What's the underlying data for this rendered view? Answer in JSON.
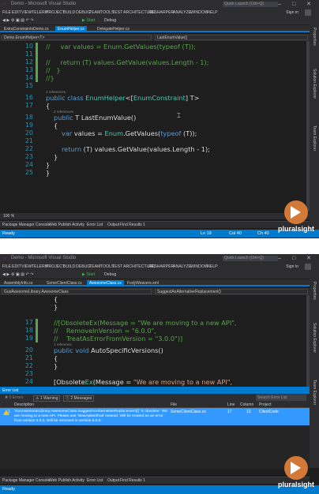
{
  "app": {
    "title": "Demo - Microsoft Visual Studio",
    "quick_launch": "Quick Launch (Ctrl+Q)",
    "menu": [
      "FILE",
      "EDIT",
      "VIEW",
      "TELERIK",
      "PROJECT",
      "BUILD",
      "DEBUG",
      "TEAM",
      "TOOLS",
      "TEST",
      "ARCHITECTURE",
      "RESHARPER",
      "ANALYZE",
      "WINDOW",
      "HELP"
    ],
    "sign_in": "Sign in",
    "toolbar": {
      "start": "▶ Start",
      "config": "Debug"
    },
    "window_buttons": "‒ □ ✕",
    "right_panels": [
      "Properties",
      "Solution Explorer",
      "Team Explorer"
    ],
    "brand_color": "#007acc",
    "pluralsight": "pluralsight"
  },
  "panel1": {
    "tabs": [
      "ExtraConstraintsDemo.cs",
      "EnumHelper.cs",
      "DelegateHelper.cs"
    ],
    "active_tab_index": 1,
    "nav": {
      "type": "Demo.EnumHelper<T>",
      "member": "LastEnumValue()"
    },
    "references_label": "2 references",
    "zoom": "100 %",
    "tool_windows": [
      "Package Manager Console",
      "Web Publish Activity",
      "Error List",
      "Output",
      "Find Results 1"
    ],
    "status": {
      "left": "Ready",
      "ln": "Ln 18",
      "col": "Col 40",
      "ch": "Ch 40"
    },
    "lines": [
      {
        "n": "10",
        "bar": true,
        "indent": 0,
        "parts": [
          {
            "c": "cmt",
            "t": "//     var values = Enum.GetValues(typeof (T));"
          }
        ]
      },
      {
        "n": "11",
        "bar": true,
        "indent": 0,
        "parts": [
          {
            "c": "cmt",
            "t": ""
          }
        ]
      },
      {
        "n": "12",
        "bar": true,
        "indent": 0,
        "parts": [
          {
            "c": "cmt",
            "t": "//     return (T) values.GetValue(values.Length - 1);"
          }
        ]
      },
      {
        "n": "13",
        "bar": true,
        "indent": 0,
        "parts": [
          {
            "c": "cmt",
            "t": "//   }"
          }
        ]
      },
      {
        "n": "14",
        "bar": true,
        "indent": 0,
        "parts": [
          {
            "c": "cmt",
            "t": "//}"
          }
        ]
      },
      {
        "n": "15",
        "bar": false,
        "indent": 0,
        "parts": []
      },
      {
        "n": "16",
        "bar": false,
        "indent": 0,
        "parts": [
          {
            "c": "kw",
            "t": "public class "
          },
          {
            "c": "typ",
            "t": "EnumHelper"
          },
          {
            "c": "pln",
            "t": "<["
          },
          {
            "c": "typ",
            "t": "EnumConstraint"
          },
          {
            "c": "pln",
            "t": "] T>"
          }
        ]
      },
      {
        "n": "17",
        "bar": false,
        "indent": 0,
        "parts": [
          {
            "c": "pln",
            "t": "{"
          }
        ]
      },
      {
        "n": "18",
        "bar": false,
        "indent": 1,
        "parts": [
          {
            "c": "kw",
            "t": "public "
          },
          {
            "c": "pln",
            "t": "T LastEnumValue()"
          }
        ]
      },
      {
        "n": "19",
        "bar": false,
        "indent": 1,
        "parts": [
          {
            "c": "pln",
            "t": "{"
          }
        ]
      },
      {
        "n": "20",
        "bar": false,
        "indent": 2,
        "parts": [
          {
            "c": "kw",
            "t": "var "
          },
          {
            "c": "pln",
            "t": "values = "
          },
          {
            "c": "typ",
            "t": "Enum"
          },
          {
            "c": "pln",
            "t": ".GetValues("
          },
          {
            "c": "kw",
            "t": "typeof"
          },
          {
            "c": "pln",
            "t": " (T));"
          }
        ]
      },
      {
        "n": "21",
        "bar": false,
        "indent": 0,
        "parts": []
      },
      {
        "n": "22",
        "bar": false,
        "indent": 2,
        "parts": [
          {
            "c": "kw",
            "t": "return "
          },
          {
            "c": "pln",
            "t": "(T) values.GetValue(values.Length - 1);"
          }
        ]
      },
      {
        "n": "23",
        "bar": false,
        "indent": 1,
        "parts": [
          {
            "c": "pln",
            "t": "}"
          }
        ]
      },
      {
        "n": "24",
        "bar": false,
        "indent": 0,
        "parts": [
          {
            "c": "pln",
            "t": "}"
          }
        ]
      },
      {
        "n": "25",
        "bar": false,
        "indent": 0,
        "parts": [
          {
            "c": "pln",
            "t": "}"
          }
        ]
      }
    ]
  },
  "panel2": {
    "tabs": [
      "AssemblyInfo.cs",
      "SomeClientClass.cs",
      "AwesomeClass.cs",
      "FodyWeavers.xml"
    ],
    "active_tab_index": 2,
    "nav": {
      "type": "GusAwesomeLibrary.AwesomeClass",
      "member": "SuggestAnAlternativeReplacement()"
    },
    "references_label": "1 reference",
    "lines": [
      {
        "n": "",
        "bar": false,
        "indent": 1,
        "parts": [
          {
            "c": "pln",
            "t": "{"
          }
        ]
      },
      {
        "n": "",
        "bar": false,
        "indent": 1,
        "parts": [
          {
            "c": "pln",
            "t": "}"
          }
        ]
      },
      {
        "n": "",
        "bar": false,
        "indent": 0,
        "parts": []
      },
      {
        "n": "17",
        "bar": true,
        "indent": 1,
        "parts": [
          {
            "c": "cmt",
            "t": "//[ObsoleteEx(Message = \"We are moving to a new API\","
          }
        ]
      },
      {
        "n": "18",
        "bar": true,
        "indent": 1,
        "parts": [
          {
            "c": "cmt",
            "t": "//    RemoveInVersion = \"6.0.0\","
          }
        ]
      },
      {
        "n": "19",
        "bar": true,
        "indent": 1,
        "parts": [
          {
            "c": "cmt",
            "t": "//    TreatAsErrorFromVersion = \"3.0.0\")]"
          }
        ]
      },
      {
        "n": "20",
        "bar": false,
        "indent": 1,
        "parts": [
          {
            "c": "kw",
            "t": "public void "
          },
          {
            "c": "pln",
            "t": "AutoSpecificVersions()"
          }
        ]
      },
      {
        "n": "21",
        "bar": false,
        "indent": 1,
        "parts": [
          {
            "c": "pln",
            "t": "{"
          }
        ]
      },
      {
        "n": "22",
        "bar": false,
        "indent": 1,
        "parts": [
          {
            "c": "pln",
            "t": "}"
          }
        ]
      },
      {
        "n": "23",
        "bar": false,
        "indent": 0,
        "parts": []
      },
      {
        "n": "24",
        "bar": false,
        "indent": 1,
        "parts": [
          {
            "c": "pln",
            "t": "[Obsolete"
          },
          {
            "c": "typ",
            "t": "Ex"
          },
          {
            "c": "pln",
            "t": "(Message = "
          },
          {
            "c": "str",
            "t": "\"We are moving to a new API\","
          }
        ]
      }
    ],
    "error_list": {
      "title": "Error List",
      "errors": "✖ 0 Errors",
      "warnings": "⚠ 1 Warning",
      "messages": "ⓘ 2 Messages",
      "search_placeholder": "Search Error List",
      "columns": [
        "Description",
        "File",
        "Line",
        "Column",
        "Project"
      ],
      "row": {
        "num": "1",
        "description": "'GusAwesomeLibrary.AwesomeClass.SuggestAnAlternativeReplacement()' is obsolete: 'We are moving to a new API. Please use 'NewApiMethod' instead. Will be treated as an error from version 3.0.0. Will be removed in version 6.0.0.'",
        "file": "SomeClientClass.cs",
        "line": "17",
        "column": "13",
        "project": "ClientCode"
      }
    },
    "tool_windows": [
      "Package Manager Console",
      "Web Publish Activity",
      "Error List",
      "Output",
      "Find Results 1"
    ],
    "status": {
      "left": "Ready"
    }
  }
}
